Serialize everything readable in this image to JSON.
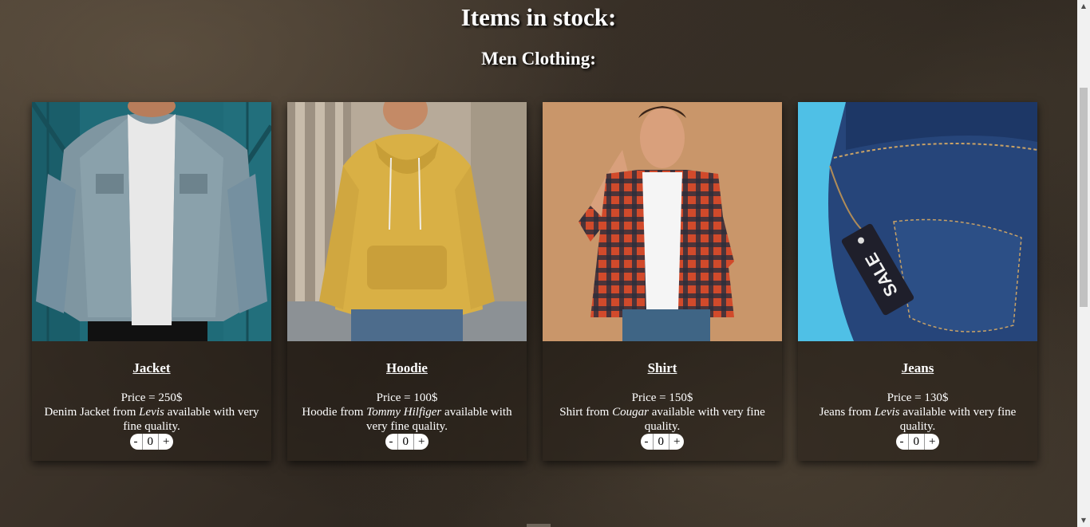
{
  "page": {
    "title": "Items in stock:",
    "subtitle": "Men Clothing:"
  },
  "products": [
    {
      "name": "Jacket",
      "price": "Price = 250$",
      "desc_before": "Denim Jacket from ",
      "brand": "Levis",
      "desc_after": " available with very fine quality.",
      "qty": "0",
      "minus": "-",
      "plus": "+"
    },
    {
      "name": "Hoodie",
      "price": "Price = 100$",
      "desc_before": "Hoodie from ",
      "brand": "Tommy Hilfiger",
      "desc_after": " available with very fine quality.",
      "qty": "0",
      "minus": "-",
      "plus": "+"
    },
    {
      "name": "Shirt",
      "price": "Price = 150$",
      "desc_before": "Shirt from ",
      "brand": "Cougar",
      "desc_after": " available with very fine quality.",
      "qty": "0",
      "minus": "-",
      "plus": "+"
    },
    {
      "name": "Jeans",
      "price": "Price = 130$",
      "desc_before": "Jeans from ",
      "brand": "Levis",
      "desc_after": " available with very fine quality.",
      "qty": "0",
      "minus": "-",
      "plus": "+",
      "tag_text": "SALE"
    }
  ]
}
